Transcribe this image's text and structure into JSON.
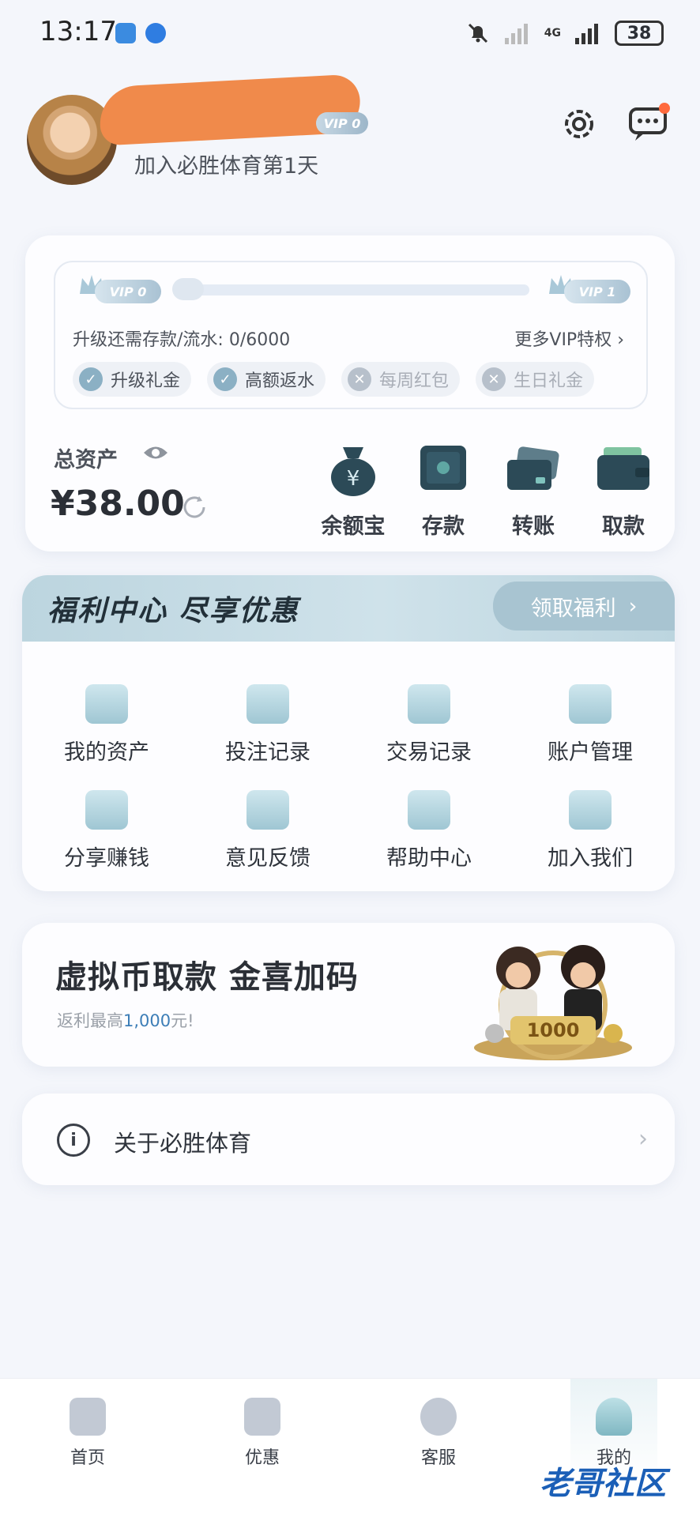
{
  "status_bar": {
    "time": "13:17",
    "battery": "38",
    "network": "4G"
  },
  "header": {
    "vip_level": "VIP 0",
    "join_text": "加入必胜体育第1天"
  },
  "vip_card": {
    "current_level": "VIP 0",
    "next_level": "VIP 1",
    "progress": 0,
    "upgrade_text": "升级还需存款/流水: 0/6000",
    "more_link": "更多VIP特权 ›",
    "perks": [
      {
        "label": "升级礼金",
        "enabled": true
      },
      {
        "label": "高额返水",
        "enabled": true
      },
      {
        "label": "每周红包",
        "enabled": false
      },
      {
        "label": "生日礼金",
        "enabled": false
      }
    ]
  },
  "assets": {
    "label": "总资产",
    "value": "¥38.00",
    "actions": [
      {
        "label": "余额宝",
        "icon": "money-bag-icon"
      },
      {
        "label": "存款",
        "icon": "safe-icon"
      },
      {
        "label": "转账",
        "icon": "cards-icon"
      },
      {
        "label": "取款",
        "icon": "wallet-icon"
      }
    ]
  },
  "welfare": {
    "title": "福利中心 尽享优惠",
    "claim_label": "领取福利",
    "items": [
      {
        "label": "我的资产",
        "icon": "wallet-icon"
      },
      {
        "label": "投注记录",
        "icon": "bet-record-icon"
      },
      {
        "label": "交易记录",
        "icon": "transaction-icon"
      },
      {
        "label": "账户管理",
        "icon": "account-icon"
      },
      {
        "label": "分享赚钱",
        "icon": "share-money-icon"
      },
      {
        "label": "意见反馈",
        "icon": "feedback-icon"
      },
      {
        "label": "帮助中心",
        "icon": "help-icon"
      },
      {
        "label": "加入我们",
        "icon": "join-icon"
      }
    ]
  },
  "promo": {
    "title": "虚拟币取款 金喜加码",
    "subtitle_prefix": "返利最高",
    "subtitle_amount": "1,000",
    "subtitle_suffix": "元!",
    "art_number": "1000"
  },
  "about": {
    "label": "关于必胜体育"
  },
  "bottom_nav": [
    {
      "label": "首页",
      "icon": "home-icon",
      "active": false
    },
    {
      "label": "优惠",
      "icon": "promo-icon",
      "active": false
    },
    {
      "label": "客服",
      "icon": "support-icon",
      "active": false
    },
    {
      "label": "我的",
      "icon": "profile-icon",
      "active": true
    }
  ],
  "watermark": "老哥社区",
  "colors": {
    "accent": "#8bb0c4",
    "banner": "#bcd5df",
    "highlight": "#3d7eb7",
    "background": "#f4f6fb"
  }
}
